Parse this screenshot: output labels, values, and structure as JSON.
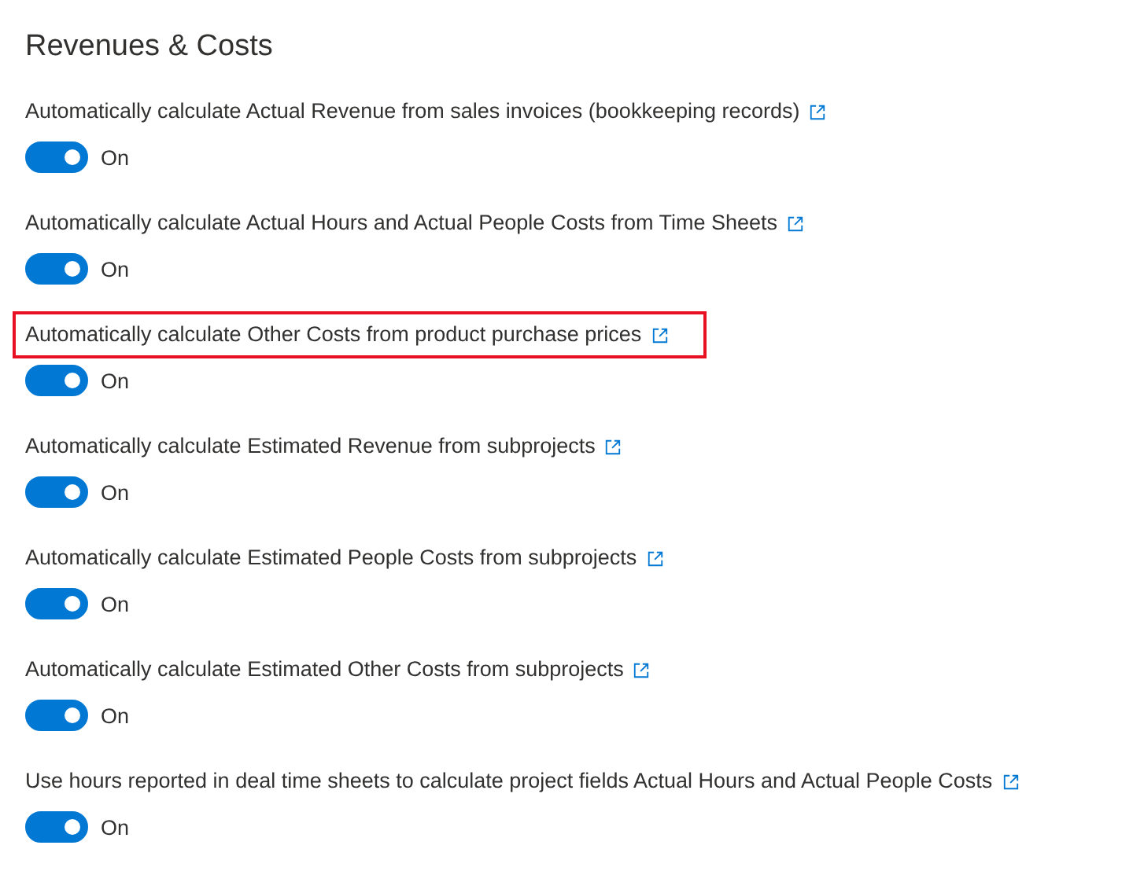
{
  "section": {
    "title": "Revenues & Costs"
  },
  "settings": [
    {
      "label": "Automatically calculate Actual Revenue from sales invoices (bookkeeping records)",
      "on": true,
      "state_text": "On",
      "highlighted": false
    },
    {
      "label": "Automatically calculate Actual Hours and Actual People Costs from Time Sheets",
      "on": true,
      "state_text": "On",
      "highlighted": false
    },
    {
      "label": "Automatically calculate Other Costs from product purchase prices",
      "on": true,
      "state_text": "On",
      "highlighted": true
    },
    {
      "label": "Automatically calculate Estimated Revenue from subprojects",
      "on": true,
      "state_text": "On",
      "highlighted": false
    },
    {
      "label": "Automatically calculate Estimated People Costs from subprojects",
      "on": true,
      "state_text": "On",
      "highlighted": false
    },
    {
      "label": "Automatically calculate Estimated Other Costs from subprojects",
      "on": true,
      "state_text": "On",
      "highlighted": false
    },
    {
      "label": "Use hours reported in deal time sheets to calculate project fields Actual Hours and Actual People Costs",
      "on": true,
      "state_text": "On",
      "highlighted": false
    }
  ]
}
